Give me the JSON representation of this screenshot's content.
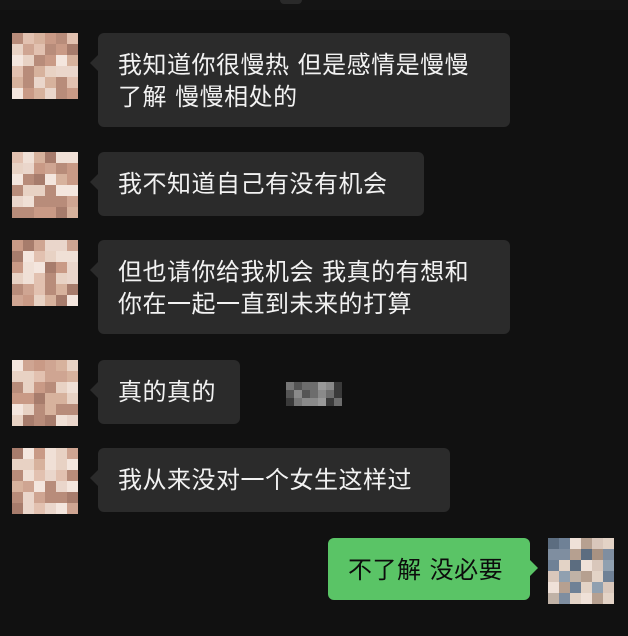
{
  "conversation": {
    "messages": [
      {
        "sender": "other",
        "line1": "我知道你很慢热 但是感情是慢慢",
        "line2": "了解 慢慢相处的"
      },
      {
        "sender": "other",
        "line1": "我不知道自己有没有机会"
      },
      {
        "sender": "other",
        "line1": "但也请你给我机会 我真的有想和",
        "line2": "你在一起一直到未来的打算"
      },
      {
        "sender": "other",
        "line1": "真的真的"
      },
      {
        "sender": "other",
        "line1": "我从来没对一个女生这样过"
      },
      {
        "sender": "me",
        "line1": "不了解 没必要"
      }
    ]
  },
  "theme": {
    "background": "#111111",
    "incoming_bubble": "#2b2b2b",
    "outgoing_bubble": "#5ac466",
    "incoming_text": "#f2f2f2",
    "outgoing_text": "#0c0c0c"
  },
  "avatars": {
    "other": "pixelated-avatar",
    "me": "pixelated-avatar"
  }
}
